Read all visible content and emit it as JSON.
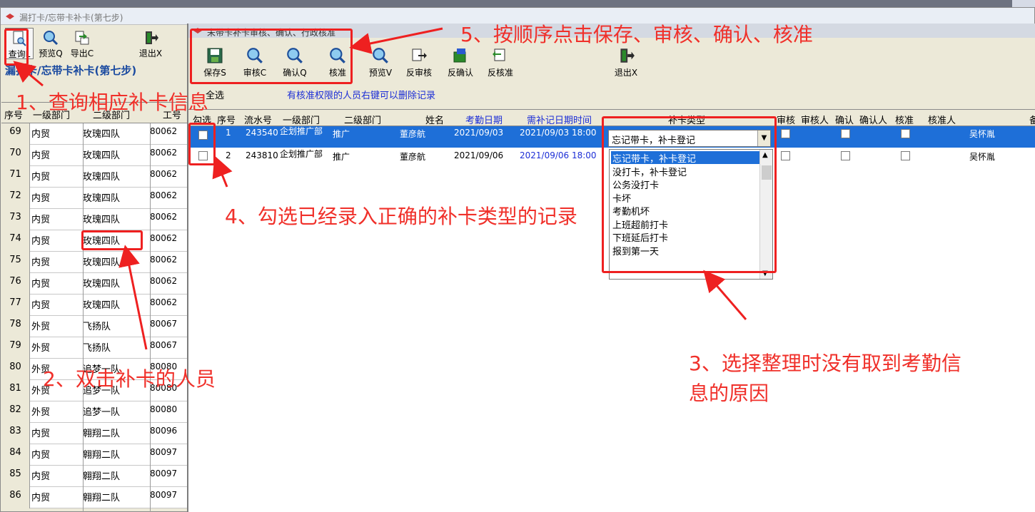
{
  "main_window": {
    "title": "漏打卡/忘带卡补卡(第七步)"
  },
  "left_toolbar": [
    {
      "label": "查询L",
      "icon": "document-search-icon"
    },
    {
      "label": "预览Q",
      "icon": "magnifier-icon"
    },
    {
      "label": "导出C",
      "icon": "export-icon"
    },
    {
      "label": "退出X",
      "icon": "exit-icon"
    }
  ],
  "page_heading": "漏打卡/忘带卡补卡(第七步)",
  "left_grid": {
    "headers": [
      "序号",
      "一级部门",
      "二级部门",
      "工号"
    ],
    "rows": [
      [
        "69",
        "内贸",
        "玫瑰四队",
        "80062"
      ],
      [
        "70",
        "内贸",
        "玫瑰四队",
        "80062"
      ],
      [
        "71",
        "内贸",
        "玫瑰四队",
        "80062"
      ],
      [
        "72",
        "内贸",
        "玫瑰四队",
        "80062"
      ],
      [
        "73",
        "内贸",
        "玫瑰四队",
        "80062"
      ],
      [
        "74",
        "内贸",
        "玫瑰四队",
        "80062"
      ],
      [
        "75",
        "内贸",
        "玫瑰四队",
        "80062"
      ],
      [
        "76",
        "内贸",
        "玫瑰四队",
        "80062"
      ],
      [
        "77",
        "内贸",
        "玫瑰四队",
        "80062"
      ],
      [
        "78",
        "外贸",
        "飞扬队",
        "80067"
      ],
      [
        "79",
        "外贸",
        "飞扬队",
        "80067"
      ],
      [
        "80",
        "外贸",
        "追梦一队",
        "80080"
      ],
      [
        "81",
        "外贸",
        "追梦一队",
        "80080"
      ],
      [
        "82",
        "外贸",
        "追梦一队",
        "80080"
      ],
      [
        "83",
        "内贸",
        "翱翔二队",
        "80096"
      ],
      [
        "84",
        "内贸",
        "翱翔二队",
        "80097"
      ],
      [
        "85",
        "内贸",
        "翱翔二队",
        "80097"
      ],
      [
        "86",
        "内贸",
        "翱翔二队",
        "80097"
      ]
    ]
  },
  "dialog": {
    "title": "未带卡补卡审核、确认、行政核准",
    "toolbar": [
      {
        "label": "保存S",
        "icon": "save-icon"
      },
      {
        "label": "审核C",
        "icon": "magnifier-icon"
      },
      {
        "label": "确认Q",
        "icon": "magnifier-icon"
      },
      {
        "label": "核准",
        "icon": "magnifier-icon"
      },
      {
        "label": "预览V",
        "icon": "magnifier-icon"
      },
      {
        "label": "反审核",
        "icon": "undo-audit-icon"
      },
      {
        "label": "反确认",
        "icon": "undo-confirm-icon"
      },
      {
        "label": "反核准",
        "icon": "undo-approve-icon"
      },
      {
        "label": "退出X",
        "icon": "exit-icon"
      }
    ],
    "select_all": "全选",
    "hint": "有核准权限的人员右键可以删除记录",
    "headers": [
      "勾选",
      "序号",
      "流水号",
      "一级部门",
      "二级部门",
      "姓名",
      "考勤日期",
      "需补记日期时间",
      "补卡类型",
      "审核",
      "审核人",
      "确认",
      "确认人",
      "核准",
      "核准人",
      "备"
    ],
    "rows": [
      {
        "seq": "1",
        "serial": "243540",
        "dept1": "企划推广部",
        "dept2": "推广",
        "name": "董彦航",
        "date": "2021/09/03",
        "datetime": "2021/09/03 18:00",
        "type": "忘记带卡，补卡登记",
        "approver": "吴怀胤",
        "selected": true
      },
      {
        "seq": "2",
        "serial": "243810",
        "dept1": "企划推广部",
        "dept2": "推广",
        "name": "董彦航",
        "date": "2021/09/06",
        "datetime": "2021/09/06 18:00",
        "type": "",
        "approver": "吴怀胤",
        "selected": false
      }
    ],
    "dropdown_value": "忘记带卡，补卡登记",
    "dropdown_options": [
      "忘记带卡，补卡登记",
      "没打卡，补卡登记",
      "公务没打卡",
      "卡坏",
      "考勤机坏",
      "上班超前打卡",
      "下班延后打卡",
      "报到第一天"
    ]
  },
  "annotations": {
    "a1": "1、查询相应补卡信息",
    "a2": "2、双击补卡的人员",
    "a3_line1": "3、选择整理时没有取到考勤信",
    "a3_line2": "息的原因",
    "a4": "4、勾选已经录入正确的补卡类型的记录",
    "a5": "5、按顺序点击保存、审核、确认、核准"
  },
  "colors": {
    "annotation": "#f0302a",
    "selection": "#1e6fd8",
    "heading": "#1a4aa0",
    "hint": "#1c2ed6"
  }
}
